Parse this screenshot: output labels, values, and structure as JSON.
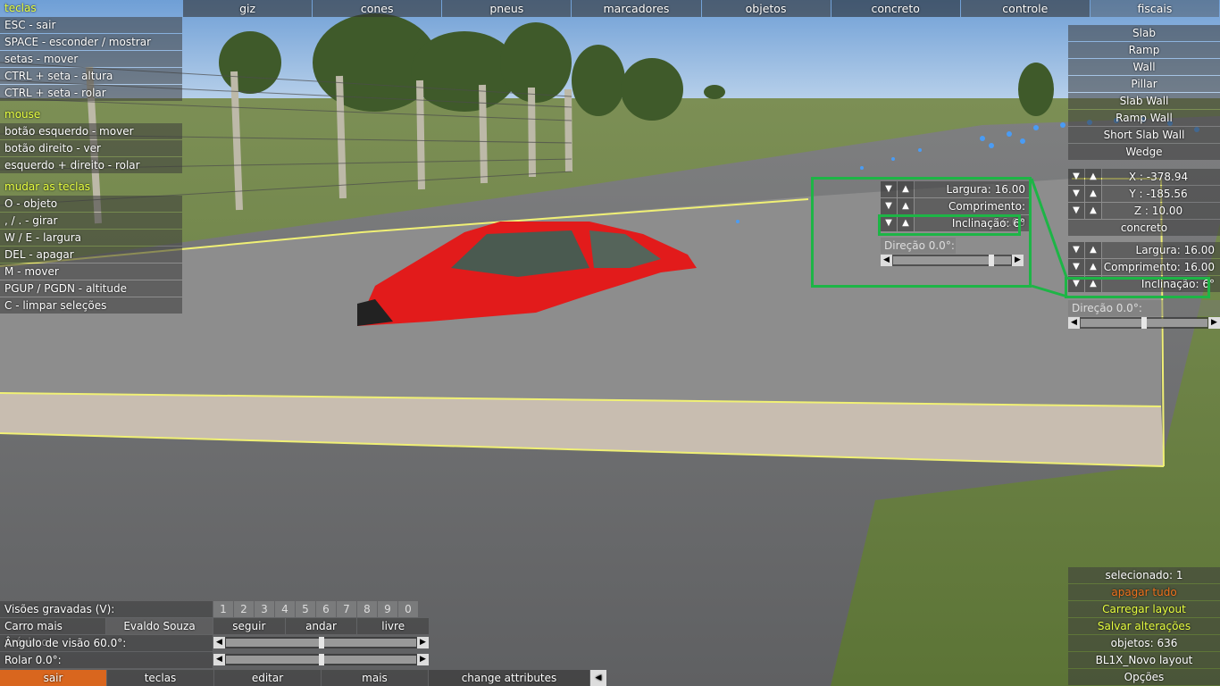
{
  "keys_panel": {
    "title": "teclas",
    "items": [
      "ESC - sair",
      "SPACE - esconder / mostrar",
      "setas - mover",
      "CTRL + seta - altura",
      "CTRL + seta - rolar"
    ],
    "mouse_title": "mouse",
    "mouse_items": [
      "botão esquerdo - mover",
      "botão direito - ver",
      "esquerdo + direito - rolar"
    ],
    "change_title": "mudar as teclas",
    "change_items": [
      "O - objeto",
      ", / . - girar",
      "W / E - largura",
      "DEL - apagar",
      "M - mover",
      "PGUP / PGDN - altitude",
      "C - limpar seleções"
    ]
  },
  "top_tabs": [
    "giz",
    "cones",
    "pneus",
    "marcadores",
    "objetos",
    "concreto",
    "controle",
    "fiscais"
  ],
  "top_tabs_active": "concreto",
  "concrete_types": [
    "Slab",
    "Ramp",
    "Wall",
    "Pillar",
    "Slab Wall",
    "Ramp Wall",
    "Short Slab Wall",
    "Wedge"
  ],
  "coords": {
    "x": "X : -378.94",
    "y": "Y : -185.56",
    "z": "Z : 10.00"
  },
  "material": "concreto",
  "props": {
    "width": "Largura: 16.00",
    "length": "Comprimento: 16.00",
    "incline": "Inclinação: 6°",
    "direction": "Direção 0.0°:"
  },
  "arrows": {
    "down": "▼",
    "up": "▲",
    "left": "◀",
    "right": "▶"
  },
  "slider_levels": {
    "main_direction": 0.5,
    "panel_direction": 0.85,
    "view_angle": 0.5,
    "roll": 0.5
  },
  "bottom_panel": {
    "saved_views_label": "Visões gravadas (V):",
    "view_numbers": [
      "1",
      "2",
      "3",
      "4",
      "5",
      "6",
      "7",
      "8",
      "9",
      "0"
    ],
    "nearest_car_label": "Carro mais próximo:",
    "driver_name": "Evaldo Souza",
    "follow": "seguir",
    "walk": "andar",
    "free": "livre",
    "view_angle": "Ângulo de visão 60.0°:",
    "roll": "Rolar 0.0°:"
  },
  "bottom_bar": {
    "exit": "sair",
    "keys": "teclas",
    "edit": "editar",
    "more": "mais",
    "change_attributes": "change attributes"
  },
  "bottom_right": {
    "selected": "selecionado: 1",
    "delete_all": "apagar tudo",
    "load_layout": "Carregar layout",
    "save_changes": "Salvar alterações",
    "objects": "objetos: 636",
    "layout_name": "BL1X_Novo layout",
    "options": "Opções"
  },
  "colors": {
    "accent_yellow": "#e8ff40",
    "exit_orange": "#d9661e",
    "highlight_green": "#1db546",
    "car_red": "#e21b1b"
  }
}
